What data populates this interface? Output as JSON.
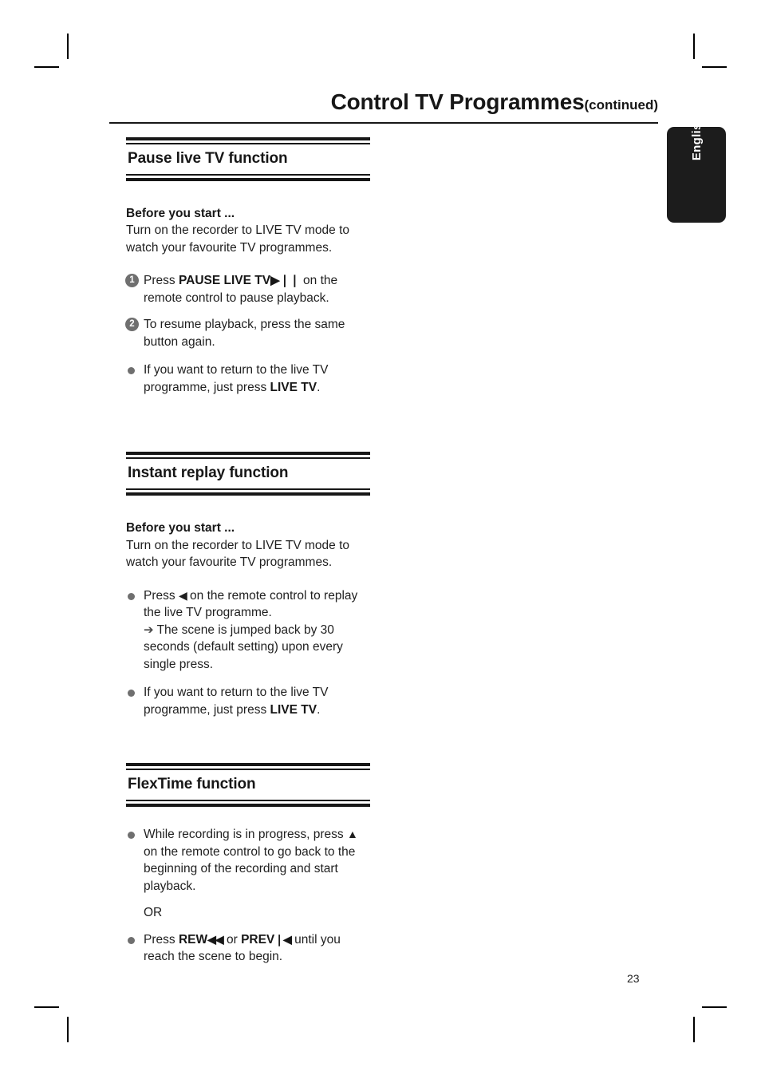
{
  "page": {
    "title_main": "Control TV Programmes",
    "title_continued": "(continued)",
    "language_tab": "English",
    "page_number": "23"
  },
  "sections": [
    {
      "heading": "Pause live TV function",
      "intro_title": "Before you start ...",
      "intro_body": "Turn on the recorder to LIVE TV mode to watch your favourite TV programmes.",
      "steps": [
        {
          "marker": "1",
          "text_before": "Press ",
          "bold": "PAUSE LIVE TV",
          "glyph": "▶❘❘",
          "text_after": " on the remote control to pause playback."
        },
        {
          "marker": "2",
          "text_before": "To resume playback, press the same button again."
        }
      ],
      "bullets": [
        {
          "text_before": "If you want to return to the live TV programme, just press ",
          "bold": "LIVE TV",
          "text_after": "."
        }
      ]
    },
    {
      "heading": "Instant replay function",
      "intro_title": "Before you start ...",
      "intro_body": "Turn on the recorder to LIVE TV mode to watch your favourite TV programmes.",
      "bullets": [
        {
          "text_before": "Press ",
          "glyph": "◀",
          "text_after": " on the remote control to replay the live TV programme.",
          "note_arrow": "➔",
          "note": "The scene is jumped back by 30 seconds (default setting) upon every single press."
        },
        {
          "text_before": "If you want to return to the live TV programme, just press ",
          "bold": "LIVE TV",
          "text_after": "."
        }
      ]
    },
    {
      "heading": "FlexTime function",
      "bullets": [
        {
          "text_before": "While recording is in progress, press ",
          "glyph": "▲",
          "text_after": " on the remote control to go back to the beginning of the recording and start playback."
        }
      ],
      "or_label": "OR",
      "bullets2": [
        {
          "text_before": "Press ",
          "bold": "REW",
          "glyph": "◀◀",
          "text_mid": " or ",
          "bold2": "PREV",
          "glyph2": "❘◀",
          "text_after": " until you reach the scene to begin."
        }
      ]
    }
  ]
}
